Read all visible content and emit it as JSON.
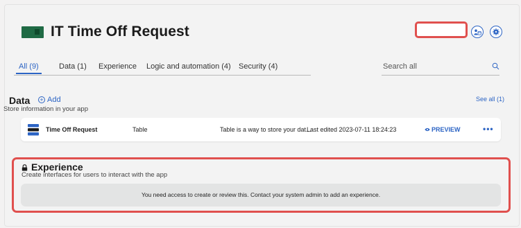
{
  "app": {
    "title": "IT Time Off Request"
  },
  "header": {
    "user_icon": "user-database-icon",
    "settings_icon": "gear-icon"
  },
  "tabs": [
    {
      "label": "All (9)",
      "active": true
    },
    {
      "label": "Data (1)",
      "active": false
    },
    {
      "label": "Experience",
      "active": false
    },
    {
      "label": "Logic and automation (4)",
      "active": false
    },
    {
      "label": "Security (4)",
      "active": false
    }
  ],
  "search": {
    "placeholder": "Search all"
  },
  "data_section": {
    "title": "Data",
    "add_label": "Add",
    "description": "Store information in your app",
    "see_all": "See all (1)",
    "rows": [
      {
        "name": "Time Off Request",
        "type": "Table",
        "description": "Table is a way to store your dat...",
        "edited": "Last edited 2023-07-11 18:24:23",
        "preview": "PREVIEW",
        "more": "•••"
      }
    ]
  },
  "experience_section": {
    "title": "Experience",
    "description": "Create interfaces for users to interact with the app",
    "notice": "You need access to create or review this. Contact your system admin to add an experience."
  },
  "colors": {
    "accent": "#2c64c4",
    "highlight": "#e0504e",
    "logo": "#1f6a44"
  }
}
